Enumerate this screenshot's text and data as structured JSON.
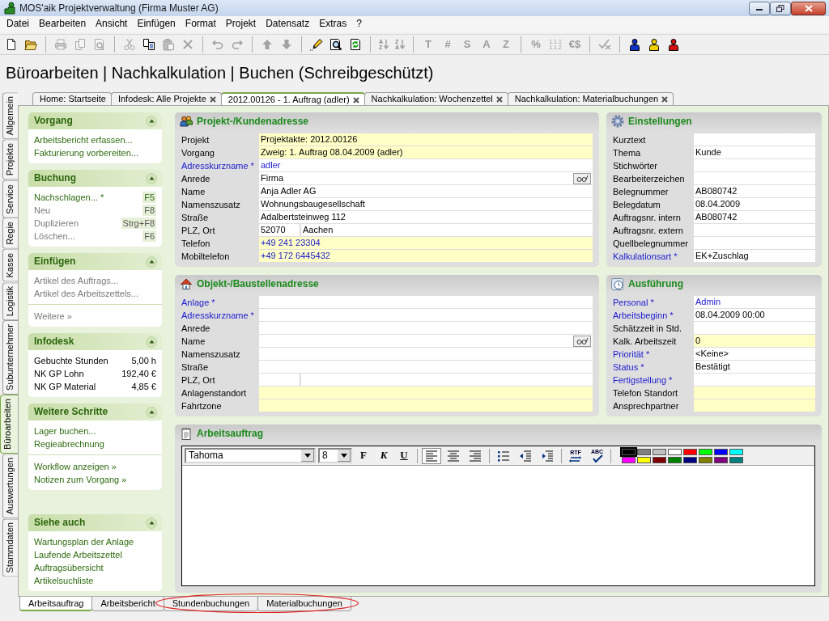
{
  "window": {
    "title": "MOS'aik Projektverwaltung (Firma Muster AG)"
  },
  "menu": [
    "Datei",
    "Bearbeiten",
    "Ansicht",
    "Einfügen",
    "Format",
    "Projekt",
    "Datensatz",
    "Extras",
    "?"
  ],
  "toolbar": [
    [
      {
        "kind": "icon",
        "disabled": false
      },
      {
        "kind": "icon",
        "disabled": false
      }
    ],
    [
      {
        "kind": "icon",
        "disabled": true
      },
      {
        "kind": "icon",
        "disabled": true
      },
      {
        "kind": "icon",
        "disabled": true
      }
    ],
    [
      {
        "kind": "icon",
        "disabled": true
      },
      {
        "kind": "icon",
        "disabled": false
      },
      {
        "kind": "icon",
        "disabled": true
      },
      {
        "kind": "icon",
        "disabled": true
      }
    ],
    [
      {
        "kind": "icon",
        "disabled": true
      },
      {
        "kind": "icon",
        "disabled": true
      }
    ],
    [
      {
        "kind": "icon",
        "disabled": true
      },
      {
        "kind": "icon",
        "disabled": true
      }
    ],
    [
      {
        "kind": "icon",
        "disabled": false
      },
      {
        "kind": "icon",
        "disabled": false
      },
      {
        "kind": "icon",
        "disabled": false
      }
    ],
    [
      {
        "kind": "sort",
        "text": "AZ",
        "disabled": true
      },
      {
        "kind": "sort",
        "text": "ZA",
        "disabled": true
      }
    ],
    [
      {
        "kind": "glyph",
        "text": "T",
        "disabled": true
      },
      {
        "kind": "glyph",
        "text": "#",
        "disabled": true
      },
      {
        "kind": "glyph",
        "text": "S",
        "disabled": true
      },
      {
        "kind": "glyph",
        "text": "A",
        "disabled": true
      },
      {
        "kind": "glyph",
        "text": "Z",
        "disabled": true
      }
    ],
    [
      {
        "kind": "glyph",
        "text": "%",
        "disabled": true
      },
      {
        "kind": "stack",
        "text": "1.1.1 1.1.2",
        "disabled": true
      },
      {
        "kind": "glyph",
        "text": "€$",
        "disabled": true
      }
    ],
    [
      {
        "kind": "icon",
        "disabled": true
      }
    ],
    [
      {
        "kind": "icon",
        "disabled": false,
        "color": "#1030c0"
      },
      {
        "kind": "icon",
        "disabled": false,
        "color": "#f0d000"
      },
      {
        "kind": "icon",
        "disabled": false,
        "color": "#d01010"
      }
    ]
  ],
  "heading": "Büroarbeiten | Nachkalkulation | Buchen (Schreibgeschützt)",
  "side_tabs": [
    {
      "label": "Allgemein",
      "selected": false
    },
    {
      "label": "Projekte",
      "selected": false
    },
    {
      "label": "Service",
      "selected": false
    },
    {
      "label": "Regie",
      "selected": false
    },
    {
      "label": "Kasse",
      "selected": false
    },
    {
      "label": "Logistik",
      "selected": false
    },
    {
      "label": "Subunternehmer",
      "selected": false
    },
    {
      "label": "Büroarbeiten",
      "selected": true
    },
    {
      "label": "Auswertungen",
      "selected": false
    },
    {
      "label": "Stammdaten",
      "selected": false
    }
  ],
  "tabs": [
    {
      "label": "Home: Startseite",
      "selected": false,
      "closable": false
    },
    {
      "label": "Infodesk: Alle Projekte",
      "selected": false,
      "closable": true
    },
    {
      "label": "2012.00126 - 1. Auftrag (adler)",
      "selected": true,
      "closable": true
    },
    {
      "label": "Nachkalkulation: Wochenzettel",
      "selected": false,
      "closable": true
    },
    {
      "label": "Nachkalkulation: Materialbuchungen",
      "selected": false,
      "closable": true
    }
  ],
  "task_panel": [
    {
      "title": "Vorgang",
      "kind": "links",
      "expanded": true,
      "groups": [
        [
          {
            "text": "Arbeitsbericht erfassen...",
            "disabled": false
          },
          {
            "text": "Fakturierung vorbereiten...",
            "disabled": false
          }
        ]
      ]
    },
    {
      "title": "Buchung",
      "kind": "links",
      "expanded": true,
      "groups": [
        [
          {
            "text": "Nachschlagen... *",
            "shortcut": "F5",
            "disabled": false
          },
          {
            "text": "Neu",
            "shortcut": "F8",
            "disabled": true
          },
          {
            "text": "Duplizieren",
            "shortcut": "Strg+F8",
            "disabled": true
          },
          {
            "text": "Löschen...",
            "shortcut": "F6",
            "disabled": true
          }
        ]
      ]
    },
    {
      "title": "Einfügen",
      "kind": "links",
      "expanded": true,
      "groups": [
        [
          {
            "text": "Artikel des Auftrags...",
            "disabled": true
          },
          {
            "text": "Artikel des Arbeitszettels...",
            "disabled": true
          }
        ],
        [
          {
            "text": "Weitere »",
            "disabled": true
          }
        ]
      ]
    },
    {
      "title": "Infodesk",
      "kind": "values",
      "expanded": true,
      "rows": [
        {
          "label": "Gebuchte Stunden",
          "value": "5,00 h"
        },
        {
          "label": "NK GP Lohn",
          "value": "192,40 €"
        },
        {
          "label": "NK GP Material",
          "value": "4,85 €"
        }
      ]
    },
    {
      "title": "Weitere Schritte",
      "kind": "links",
      "expanded": true,
      "groups": [
        [
          {
            "text": "Lager buchen...",
            "disabled": false
          },
          {
            "text": "Regieabrechnung",
            "disabled": false
          }
        ],
        [
          {
            "text": "Workflow anzeigen »",
            "disabled": false
          },
          {
            "text": "Notizen zum Vorgang »",
            "disabled": false
          }
        ]
      ]
    },
    {
      "title": "Siehe auch",
      "kind": "links",
      "expanded": true,
      "groups": [
        [
          {
            "text": "Wartungsplan der Anlage",
            "disabled": false
          },
          {
            "text": "Laufende Arbeitszettel",
            "disabled": false
          },
          {
            "text": "Auftragsübersicht",
            "disabled": false
          },
          {
            "text": "Artikelsuchliste",
            "disabled": false
          }
        ]
      ]
    }
  ],
  "panels": [
    {
      "kind": "form",
      "title": "Projekt-/Kundenadresse",
      "rows": [
        {
          "kind": "text",
          "label": "Projekt",
          "value": "Projektakte: 2012.00126",
          "required": false,
          "highlighted": true,
          "linked": false
        },
        {
          "kind": "text",
          "label": "Vorgang",
          "value": "Zweig: 1. Auftrag 08.04.2009 (adler)",
          "required": false,
          "highlighted": true,
          "linked": false
        },
        {
          "kind": "text",
          "label": "Adresskurzname *",
          "value": "adler",
          "required": true,
          "highlighted": false,
          "linked": true
        },
        {
          "kind": "lookup",
          "label": "Anrede",
          "value": "Firma",
          "required": false,
          "highlighted": false,
          "linked": false
        },
        {
          "kind": "text",
          "label": "Name",
          "value": "Anja Adler AG",
          "required": false,
          "highlighted": false,
          "linked": false
        },
        {
          "kind": "text",
          "label": "Namenszusatz",
          "value": "Wohnungsbaugesellschaft",
          "required": false,
          "highlighted": false,
          "linked": false
        },
        {
          "kind": "text",
          "label": "Straße",
          "value": "Adalbertsteinweg 112",
          "required": false,
          "highlighted": false,
          "linked": false
        },
        {
          "kind": "split",
          "label": "PLZ, Ort",
          "values": [
            "52070",
            "Aachen"
          ],
          "required": false,
          "highlighted": false,
          "linked": false
        },
        {
          "kind": "text",
          "label": "Telefon",
          "value": "+49 241 23304",
          "required": false,
          "highlighted": true,
          "linked": true
        },
        {
          "kind": "text",
          "label": "Mobiltelefon",
          "value": "+49 172 6445432",
          "required": false,
          "highlighted": true,
          "linked": true
        }
      ]
    },
    {
      "kind": "form",
      "title": "Einstellungen",
      "rows": [
        {
          "kind": "text",
          "label": "Kurztext",
          "required": false,
          "highlighted": false
        },
        {
          "kind": "text",
          "label": "Thema",
          "value": "Kunde",
          "required": false,
          "highlighted": false,
          "linked": false
        },
        {
          "kind": "text",
          "label": "Stichwörter",
          "required": false,
          "highlighted": false
        },
        {
          "kind": "text",
          "label": "Bearbeiterzeichen",
          "required": false,
          "highlighted": false
        },
        {
          "kind": "text",
          "label": "Belegnummer",
          "value": "AB080742",
          "required": false,
          "highlighted": false,
          "linked": false
        },
        {
          "kind": "text",
          "label": "Belegdatum",
          "value": "08.04.2009",
          "required": false,
          "highlighted": false,
          "linked": false
        },
        {
          "kind": "text",
          "label": "Auftragsnr. intern",
          "value": "AB080742",
          "required": false,
          "highlighted": false,
          "linked": false
        },
        {
          "kind": "text",
          "label": "Auftragsnr. extern",
          "required": false,
          "highlighted": false
        },
        {
          "kind": "text",
          "label": "Quellbelegnummer",
          "required": false,
          "highlighted": false
        },
        {
          "kind": "text",
          "label": "Kalkulationsart *",
          "value": "EK+Zuschlag",
          "required": true,
          "highlighted": false,
          "linked": false
        }
      ]
    },
    {
      "kind": "form",
      "title": "Objekt-/Baustellenadresse",
      "rows": [
        {
          "kind": "text",
          "label": "Anlage *",
          "required": true,
          "highlighted": false
        },
        {
          "kind": "text",
          "label": "Adresskurzname *",
          "required": true,
          "highlighted": false
        },
        {
          "kind": "text",
          "label": "Anrede",
          "required": false,
          "highlighted": false
        },
        {
          "kind": "lookup",
          "label": "Name",
          "required": false,
          "highlighted": false
        },
        {
          "kind": "text",
          "label": "Namenszusatz",
          "required": false,
          "highlighted": false
        },
        {
          "kind": "text",
          "label": "Straße",
          "required": false,
          "highlighted": false
        },
        {
          "kind": "split",
          "label": "PLZ, Ort",
          "required": false,
          "highlighted": false
        },
        {
          "kind": "text",
          "label": "Anlagenstandort",
          "required": false,
          "highlighted": true
        },
        {
          "kind": "text",
          "label": "Fahrtzone",
          "required": false,
          "highlighted": true
        }
      ]
    },
    {
      "kind": "form",
      "title": "Ausführung",
      "rows": [
        {
          "kind": "text",
          "label": "Personal *",
          "value": "Admin",
          "required": true,
          "highlighted": false,
          "linked": true
        },
        {
          "kind": "text",
          "label": "Arbeitsbeginn *",
          "value": "08.04.2009 00:00",
          "required": true,
          "highlighted": false,
          "linked": false
        },
        {
          "kind": "text",
          "label": "Schätzzeit in Std.",
          "required": false,
          "highlighted": false
        },
        {
          "kind": "text",
          "label": "Kalk. Arbeitszeit",
          "value": "0",
          "required": false,
          "highlighted": true,
          "linked": false
        },
        {
          "kind": "text",
          "label": "Priorität *",
          "value": "<Keine>",
          "required": true,
          "highlighted": false,
          "linked": false
        },
        {
          "kind": "text",
          "label": "Status *",
          "value": "Bestätigt",
          "required": true,
          "highlighted": false,
          "linked": false
        },
        {
          "kind": "text",
          "label": "Fertigstellung *",
          "required": true,
          "highlighted": false
        },
        {
          "kind": "text",
          "label": "Telefon Standort",
          "required": false,
          "highlighted": true
        },
        {
          "kind": "text",
          "label": "Ansprechpartner",
          "required": false,
          "highlighted": true
        }
      ]
    },
    {
      "kind": "editor",
      "title": "Arbeitsauftrag",
      "font": "Tahoma",
      "size": "8",
      "format_buttons": [
        {
          "kind": "bold",
          "text": "F"
        },
        {
          "kind": "italic",
          "text": "K"
        },
        {
          "kind": "underline",
          "text": "U"
        }
      ],
      "alignment": [
        {
          "selected": true
        },
        {
          "selected": false
        },
        {
          "selected": false
        }
      ],
      "rtf": "RTF",
      "spell": "ABC",
      "palette": [
        {
          "color": "#000000",
          "selected": true
        },
        {
          "color": "#808080",
          "selected": false
        },
        {
          "color": "#c0c0c0",
          "selected": false
        },
        {
          "color": "#ffffff",
          "selected": false
        },
        {
          "color": "#ff0000",
          "selected": false
        },
        {
          "color": "#00ff00",
          "selected": false
        },
        {
          "color": "#0000ff",
          "selected": false
        },
        {
          "color": "#00ffff",
          "selected": false
        },
        {
          "color": "#ff00ff",
          "selected": false
        },
        {
          "color": "#ffff00",
          "selected": false
        },
        {
          "color": "#800000",
          "selected": false
        },
        {
          "color": "#008000",
          "selected": false
        },
        {
          "color": "#000080",
          "selected": false
        },
        {
          "color": "#808000",
          "selected": false
        },
        {
          "color": "#800080",
          "selected": false
        },
        {
          "color": "#008080",
          "selected": false
        }
      ]
    }
  ],
  "bottom_tabs": [
    {
      "label": "Arbeitsauftrag",
      "selected": true,
      "circled": false
    },
    {
      "label": "Arbeitsbericht",
      "selected": false,
      "circled": false
    },
    {
      "label": "Stundenbuchungen",
      "selected": false,
      "circled": true
    },
    {
      "label": "Materialbuchungen",
      "selected": false,
      "circled": true
    }
  ]
}
